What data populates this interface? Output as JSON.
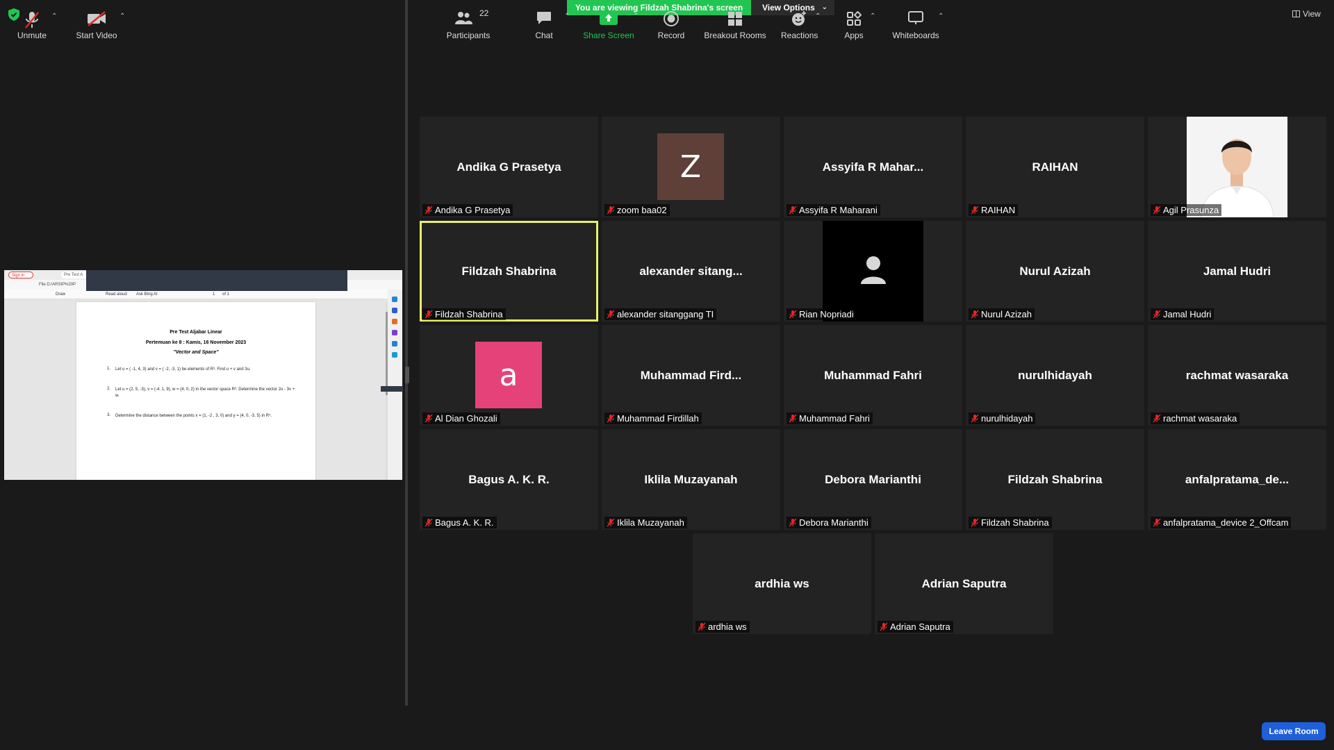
{
  "banner": {
    "viewing_text": "You are viewing Fildzah Shabrina's screen",
    "view_options": "View Options"
  },
  "view_button": {
    "label": "View"
  },
  "shared_doc": {
    "tab_signin": "Sign in",
    "tab_pdf": "Pre Test A",
    "address": "File  D:/ARSIP%20P",
    "pdf_tools": {
      "draw": "Draw",
      "read_aloud": "Read aloud",
      "ask": "Ask Bing AI",
      "page": "1",
      "of": "of 1"
    },
    "title": "Pre Test Aljabar Linear",
    "subtitle": "Pertemuan ke 8 : Kamis, 16 November 2023",
    "topic": "\"Vector and Space\"",
    "questions": [
      {
        "num": "1.",
        "text": "Let u = ( -1, 4, 3) and v = ( -2, -3, 1) be elements of R³. Find u + v and 3u."
      },
      {
        "num": "2.",
        "text": "Let u = (2, 5, -3), v = (-4, 1, 9), w = (4, 0, 2) in the vector space R³. Determine the vector 2u - 3v + w."
      },
      {
        "num": "3.",
        "text": "Determine the distance between the points x = (1, -2 , 3, 0) and y = (4, 0, -3, 5) in R⁴."
      }
    ]
  },
  "participants_grid": [
    {
      "display": "Andika G Prasetya",
      "caption": "Andika G Prasetya",
      "kind": "name"
    },
    {
      "display": "Z",
      "caption": "zoom baa02",
      "kind": "avatar",
      "color": "#5e4038"
    },
    {
      "display": "Assyifa  R  Mahar...",
      "caption": "Assyifa R Maharani",
      "kind": "name"
    },
    {
      "display": "RAIHAN",
      "caption": "RAIHAN",
      "kind": "name"
    },
    {
      "display": "",
      "caption": "Agil Prasunza",
      "kind": "photo"
    },
    {
      "display": "Fildzah Shabrina",
      "caption": "Fildzah Shabrina",
      "kind": "name",
      "active": true
    },
    {
      "display": "alexander  sitang...",
      "caption": "alexander sitanggang TI",
      "kind": "name"
    },
    {
      "display": "",
      "caption": "Rian Nopriadi",
      "kind": "silhouette"
    },
    {
      "display": "Nurul Azizah",
      "caption": "Nurul Azizah",
      "kind": "name"
    },
    {
      "display": "Jamal Hudri",
      "caption": "Jamal Hudri",
      "kind": "name"
    },
    {
      "display": "a",
      "caption": "Al Dian Ghozali",
      "kind": "avatar",
      "color": "#e6427a"
    },
    {
      "display": "Muhammad  Fird...",
      "caption": "Muhammad Firdillah",
      "kind": "name"
    },
    {
      "display": "Muhammad Fahri",
      "caption": "Muhammad Fahri",
      "kind": "name"
    },
    {
      "display": "nurulhidayah",
      "caption": "nurulhidayah",
      "kind": "name"
    },
    {
      "display": "rachmat wasaraka",
      "caption": "rachmat wasaraka",
      "kind": "name"
    },
    {
      "display": "Bagus A. K. R.",
      "caption": "Bagus A. K. R.",
      "kind": "name"
    },
    {
      "display": "Iklila Muzayanah",
      "caption": "Iklila Muzayanah",
      "kind": "name"
    },
    {
      "display": "Debora Marianthi",
      "caption": "Debora Marianthi",
      "kind": "name"
    },
    {
      "display": "Fildzah Shabrina",
      "caption": "Fildzah Shabrina",
      "kind": "name"
    },
    {
      "display": "anfalpratama_de...",
      "caption": "anfalpratama_device 2_Offcam",
      "kind": "name"
    },
    {
      "display": "ardhia ws",
      "caption": "ardhia ws",
      "kind": "name"
    },
    {
      "display": "Adrian Saputra",
      "caption": "Adrian Saputra",
      "kind": "name"
    }
  ],
  "toolbar": {
    "unmute": "Unmute",
    "start_video": "Start Video",
    "participants": "Participants",
    "participants_count": "22",
    "chat": "Chat",
    "share_screen": "Share Screen",
    "record": "Record",
    "breakout_rooms": "Breakout Rooms",
    "reactions": "Reactions",
    "apps": "Apps",
    "whiteboards": "Whiteboards",
    "leave_room": "Leave Room"
  },
  "colors": {
    "accent_green": "#23c552",
    "active_outline": "#e8f16b",
    "leave_blue": "#1f5fd9",
    "muted_red": "#e02828"
  }
}
